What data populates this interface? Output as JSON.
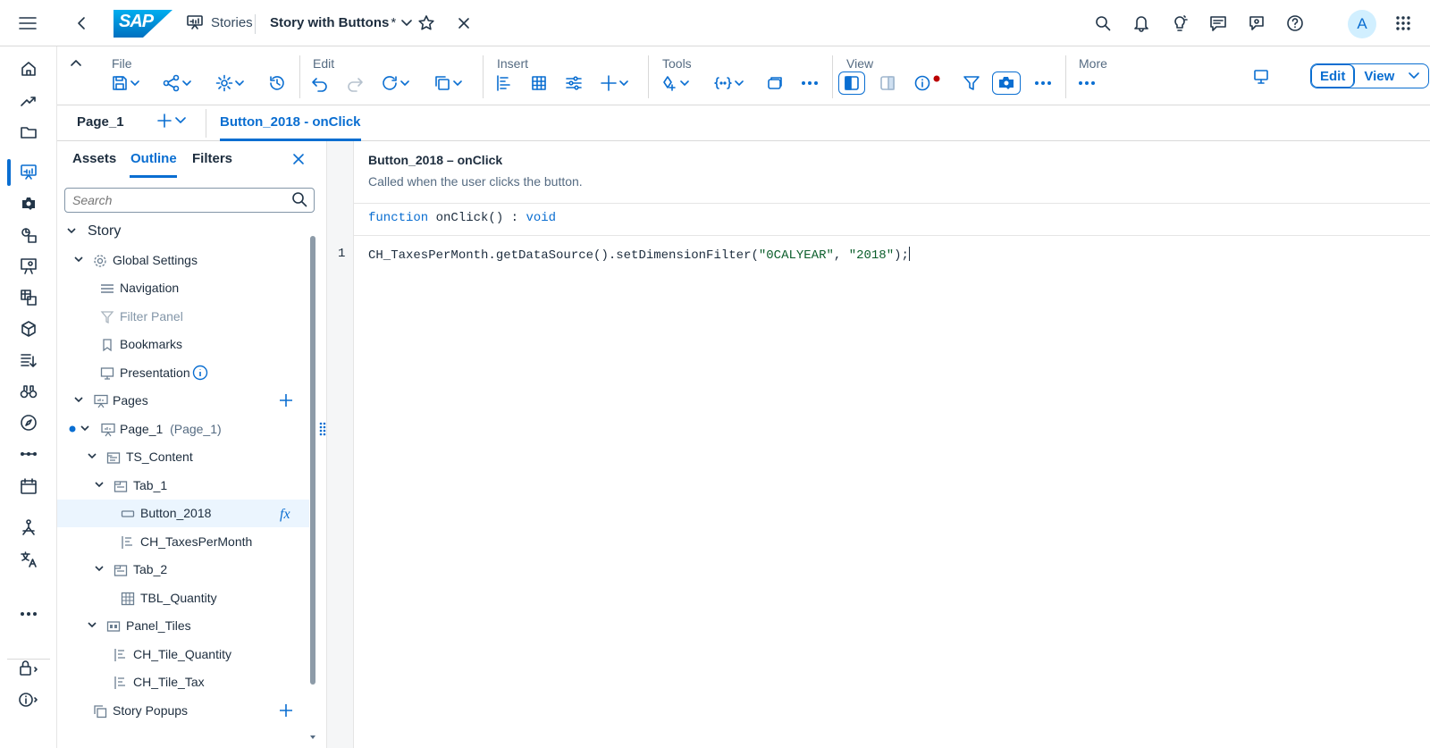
{
  "shell": {
    "logo_text": "SAP",
    "stories_label": "Stories",
    "story_title": "Story with Buttons",
    "modified_marker": "*",
    "avatar_initial": "A"
  },
  "toolbar": {
    "groups": {
      "file": "File",
      "edit": "Edit",
      "insert": "Insert",
      "tools": "Tools",
      "view": "View",
      "more": "More"
    },
    "mode_edit": "Edit",
    "mode_view": "View"
  },
  "tabs": {
    "page": "Page_1",
    "script": "Button_2018 - onClick"
  },
  "panel": {
    "tabs": [
      "Assets",
      "Outline",
      "Filters"
    ],
    "search_placeholder": "Search",
    "tree": {
      "story": "Story",
      "global_settings": "Global Settings",
      "navigation": "Navigation",
      "filter_panel": "Filter Panel",
      "bookmarks": "Bookmarks",
      "presentation": "Presentation",
      "pages": "Pages",
      "page1": "Page_1",
      "page1_id": "(Page_1)",
      "ts_content": "TS_Content",
      "tab1": "Tab_1",
      "button_2018": "Button_2018",
      "ch_taxes": "CH_TaxesPerMonth",
      "tab2": "Tab_2",
      "tbl_quantity": "TBL_Quantity",
      "panel_tiles": "Panel_Tiles",
      "ch_tile_quantity": "CH_Tile_Quantity",
      "ch_tile_tax": "CH_Tile_Tax",
      "story_popups": "Story Popups"
    }
  },
  "editor": {
    "title": "Button_2018 – onClick",
    "description": "Called when the user clicks the button.",
    "sig_keyword": "function",
    "sig_name": "onClick() :",
    "sig_type": "void",
    "line_number": "1",
    "code_prefix": "CH_TaxesPerMonth.getDataSource().setDimensionFilter(",
    "code_arg1": "\"0CALYEAR\"",
    "code_comma": ", ",
    "code_arg2": "\"2018\"",
    "code_suffix": ");"
  },
  "colors": {
    "accent": "#0a6ed1",
    "text": "#1d2d3e",
    "selected_row": "#ebf5fe",
    "notification_dot": "#bb0000"
  }
}
